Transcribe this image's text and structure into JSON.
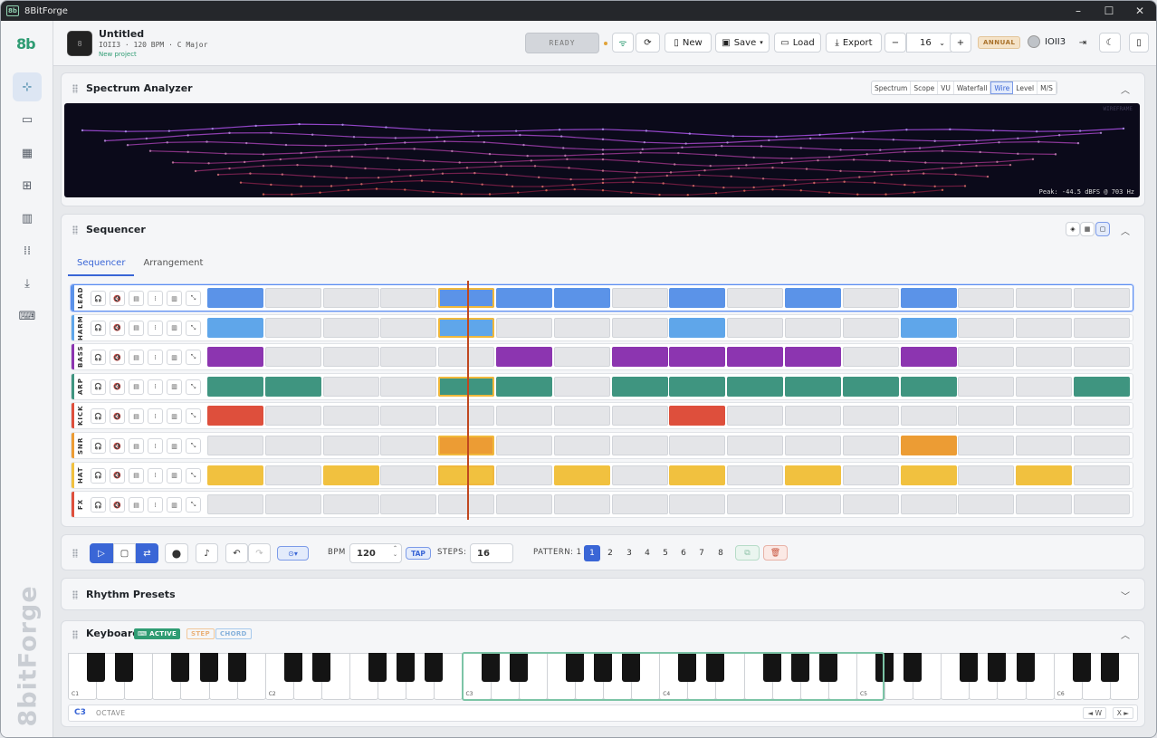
{
  "window": {
    "title": "8BitForge",
    "logo": "8b"
  },
  "sidebar": {
    "brand": "8b",
    "vertical_brand": "8bitForge",
    "items": [
      "sequencer-icon",
      "synth-icon",
      "mixer-icon",
      "grid-icon",
      "library-icon",
      "pads-icon",
      "download-icon",
      "keyboard-icon"
    ]
  },
  "project": {
    "icon": "8",
    "title": "Untitled",
    "subtitle": "IOII3 · 120 BPM · C Major",
    "note": "New project"
  },
  "toolbar": {
    "status": "READY",
    "new": "New",
    "save": "Save",
    "load": "Load",
    "export": "Export",
    "zoom_minus": "−",
    "zoom_value": "16",
    "zoom_plus": "+",
    "plan": "ANNUAL",
    "user": "IOII3"
  },
  "spectrum": {
    "title": "Spectrum Analyzer",
    "tabs": [
      "Spectrum",
      "Scope",
      "VU",
      "Waterfall",
      "Wire",
      "Level",
      "M/S"
    ],
    "active_tab": "Wire",
    "mode_label": "WIREFRAME",
    "peak": "Peak: -44.5 dBFS @ 703 Hz"
  },
  "sequencer": {
    "title": "Sequencer",
    "tabs": [
      "Sequencer",
      "Arrangement"
    ],
    "active_tab": "Sequencer",
    "steps": 16,
    "playhead_step": 5,
    "tracks": [
      {
        "name": "LEAD",
        "color": "#5b93e8",
        "steps": [
          1,
          0,
          0,
          0,
          1,
          1,
          1,
          0,
          1,
          0,
          1,
          0,
          1,
          0,
          0,
          0
        ]
      },
      {
        "name": "HARM",
        "color": "#5fa6ea",
        "steps": [
          1,
          0,
          0,
          0,
          1,
          0,
          0,
          0,
          1,
          0,
          0,
          0,
          1,
          0,
          0,
          0
        ]
      },
      {
        "name": "BASS",
        "color": "#8c35b0",
        "steps": [
          1,
          0,
          0,
          0,
          0,
          1,
          0,
          1,
          1,
          1,
          1,
          0,
          1,
          0,
          0,
          0
        ]
      },
      {
        "name": "ARP",
        "color": "#3f9580",
        "steps": [
          1,
          1,
          0,
          0,
          1,
          1,
          0,
          1,
          1,
          1,
          1,
          1,
          1,
          0,
          0,
          1
        ]
      },
      {
        "name": "KICK",
        "color": "#de4f3c",
        "steps": [
          1,
          0,
          0,
          0,
          0,
          0,
          0,
          0,
          1,
          0,
          0,
          0,
          0,
          0,
          0,
          0
        ]
      },
      {
        "name": "SNR",
        "color": "#ec9c34",
        "steps": [
          0,
          0,
          0,
          0,
          1,
          0,
          0,
          0,
          0,
          0,
          0,
          0,
          1,
          0,
          0,
          0
        ]
      },
      {
        "name": "HAT",
        "color": "#f1c13f",
        "steps": [
          1,
          0,
          1,
          0,
          1,
          0,
          1,
          0,
          1,
          0,
          1,
          0,
          1,
          0,
          1,
          0
        ]
      },
      {
        "name": "FX",
        "color": "#de4f3c",
        "steps": [
          0,
          0,
          0,
          0,
          0,
          0,
          0,
          0,
          0,
          0,
          0,
          0,
          0,
          0,
          0,
          0
        ]
      }
    ]
  },
  "transport": {
    "bpm_label": "BPM",
    "bpm": "120",
    "tap": "TAP",
    "steps_label": "STEPS:",
    "steps": "16",
    "pattern_label": "PATTERN: 1",
    "patterns": [
      "1",
      "2",
      "3",
      "4",
      "5",
      "6",
      "7",
      "8"
    ],
    "active_pattern": "1"
  },
  "rhythm": {
    "title": "Rhythm Presets"
  },
  "keyboard": {
    "title": "Keyboard",
    "active": "ACTIVE",
    "step": "STEP",
    "chord": "CHORD",
    "octave_value": "C3",
    "octave_label": "OCTAVE",
    "down": "◄ W",
    "up": "X ►",
    "labels": [
      "C1",
      "C2",
      "C3",
      "C4",
      "C5",
      "C6"
    ]
  }
}
